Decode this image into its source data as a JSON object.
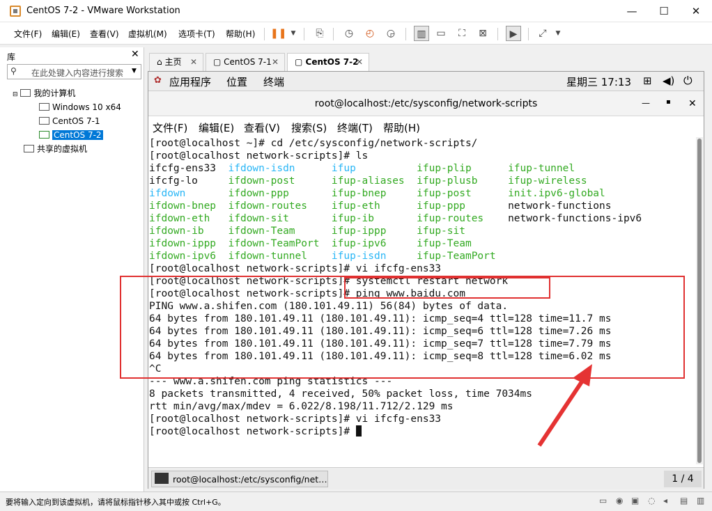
{
  "window": {
    "title": "CentOS 7-2 - VMware Workstation",
    "minimize": "—",
    "maximize": "☐",
    "close": "✕"
  },
  "menu": {
    "items": [
      "文件(F)",
      "编辑(E)",
      "查看(V)",
      "虚拟机(M)",
      "选项卡(T)",
      "帮助(H)"
    ]
  },
  "library": {
    "title": "库",
    "close": "✕",
    "search_placeholder": "在此处键入内容进行搜索",
    "root": "我的计算机",
    "vms": [
      "Windows 10 x64",
      "CentOS 7-1",
      "CentOS 7-2"
    ],
    "shared": "共享的虚拟机"
  },
  "tabs": [
    {
      "label": "主页"
    },
    {
      "label": "CentOS 7-1"
    },
    {
      "label": "CentOS 7-2"
    }
  ],
  "gnome": {
    "apps": "应用程序",
    "places": "位置",
    "terminal": "终端",
    "clock": "星期三 17:13"
  },
  "term": {
    "title": "root@localhost:/etc/sysconfig/network-scripts",
    "menu": [
      "文件(F)",
      "编辑(E)",
      "查看(V)",
      "搜索(S)",
      "终端(T)",
      "帮助(H)"
    ]
  },
  "terminal_lines": [
    {
      "text": "[root@localhost ~]# cd /etc/sysconfig/network-scripts/"
    },
    {
      "text": "[root@localhost network-scripts]# ls"
    },
    {
      "cols": [
        [
          "ifcfg-ens33",
          ""
        ],
        [
          "ifdown-isdn",
          "c"
        ],
        [
          "ifup",
          "c"
        ],
        [
          "ifup-plip",
          "g"
        ],
        [
          "ifup-tunnel",
          "g"
        ]
      ]
    },
    {
      "cols": [
        [
          "ifcfg-lo",
          ""
        ],
        [
          "ifdown-post",
          "g"
        ],
        [
          "ifup-aliases",
          "g"
        ],
        [
          "ifup-plusb",
          "g"
        ],
        [
          "ifup-wireless",
          "g"
        ]
      ]
    },
    {
      "cols": [
        [
          "ifdown",
          "c"
        ],
        [
          "ifdown-ppp",
          "g"
        ],
        [
          "ifup-bnep",
          "g"
        ],
        [
          "ifup-post",
          "g"
        ],
        [
          "init.ipv6-global",
          "g"
        ]
      ]
    },
    {
      "cols": [
        [
          "ifdown-bnep",
          "g"
        ],
        [
          "ifdown-routes",
          "g"
        ],
        [
          "ifup-eth",
          "g"
        ],
        [
          "ifup-ppp",
          "g"
        ],
        [
          "network-functions",
          ""
        ]
      ]
    },
    {
      "cols": [
        [
          "ifdown-eth",
          "g"
        ],
        [
          "ifdown-sit",
          "g"
        ],
        [
          "ifup-ib",
          "g"
        ],
        [
          "ifup-routes",
          "g"
        ],
        [
          "network-functions-ipv6",
          ""
        ]
      ]
    },
    {
      "cols": [
        [
          "ifdown-ib",
          "g"
        ],
        [
          "ifdown-Team",
          "g"
        ],
        [
          "ifup-ippp",
          "g"
        ],
        [
          "ifup-sit",
          "g"
        ],
        [
          "",
          ""
        ]
      ]
    },
    {
      "cols": [
        [
          "ifdown-ippp",
          "g"
        ],
        [
          "ifdown-TeamPort",
          "g"
        ],
        [
          "ifup-ipv6",
          "g"
        ],
        [
          "ifup-Team",
          "g"
        ],
        [
          "",
          ""
        ]
      ]
    },
    {
      "cols": [
        [
          "ifdown-ipv6",
          "g"
        ],
        [
          "ifdown-tunnel",
          "g"
        ],
        [
          "ifup-isdn",
          "c"
        ],
        [
          "ifup-TeamPort",
          "g"
        ],
        [
          "",
          ""
        ]
      ]
    },
    {
      "text": "[root@localhost network-scripts]# vi ifcfg-ens33"
    },
    {
      "text": "[root@localhost network-scripts]# systemctl restart network"
    },
    {
      "text": "[root@localhost network-scripts]# ping www.baidu.com"
    },
    {
      "text": "PING www.a.shifen.com (180.101.49.11) 56(84) bytes of data."
    },
    {
      "text": "64 bytes from 180.101.49.11 (180.101.49.11): icmp_seq=4 ttl=128 time=11.7 ms"
    },
    {
      "text": "64 bytes from 180.101.49.11 (180.101.49.11): icmp_seq=6 ttl=128 time=7.26 ms"
    },
    {
      "text": "64 bytes from 180.101.49.11 (180.101.49.11): icmp_seq=7 ttl=128 time=7.79 ms"
    },
    {
      "text": "64 bytes from 180.101.49.11 (180.101.49.11): icmp_seq=8 ttl=128 time=6.02 ms"
    },
    {
      "text": "^C"
    },
    {
      "text": "--- www.a.shifen.com ping statistics ---"
    },
    {
      "text": "8 packets transmitted, 4 received, 50% packet loss, time 7034ms"
    },
    {
      "text": "rtt min/avg/max/mdev = 6.022/8.198/11.712/2.129 ms"
    },
    {
      "text": "[root@localhost network-scripts]# vi ifcfg-ens33"
    },
    {
      "text": "[root@localhost network-scripts]# ",
      "cursor": true
    }
  ],
  "taskbar": {
    "item": "root@localhost:/etc/sysconfig/net…",
    "pager": "1 / 4"
  },
  "status": {
    "text": "要将输入定向到该虚拟机，请将鼠标指针移入其中或按 Ctrl+G。"
  },
  "colors": {
    "cyan": "#29b6f6",
    "green": "#33aa22",
    "annotation": "#e03030"
  }
}
